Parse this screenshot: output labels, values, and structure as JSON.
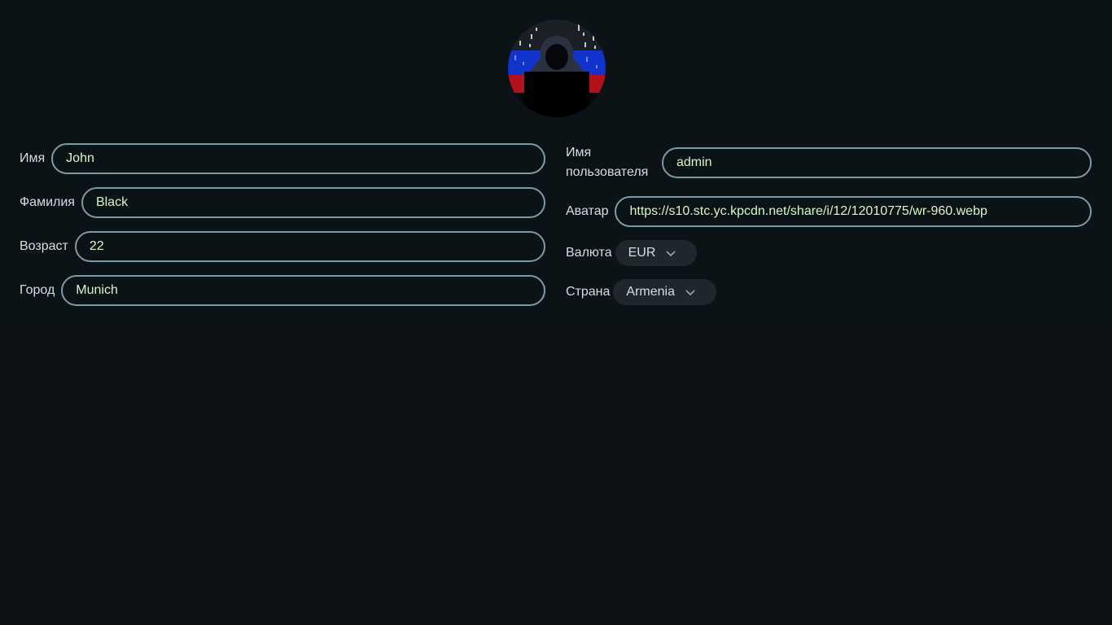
{
  "profile": {
    "avatar_alt": "hooded figure in front of binary code",
    "left_fields": [
      {
        "label": "Имя",
        "value": "John"
      },
      {
        "label": "Фамилия",
        "value": "Black"
      },
      {
        "label": "Возраст",
        "value": "22"
      },
      {
        "label": "Город",
        "value": "Munich"
      }
    ],
    "username": {
      "label": "Имя пользователя",
      "value": "admin"
    },
    "avatar_url": {
      "label": "Аватар",
      "value": "https://s10.stc.yc.kpcdn.net/share/i/12/12010775/wr-960.webp"
    },
    "currency": {
      "label": "Валюта",
      "value": "EUR"
    },
    "country": {
      "label": "Страна",
      "value": "Armenia"
    }
  },
  "colors": {
    "background": "#0b1115",
    "input_border": "#7e9aa8",
    "input_text": "#d7f5c9",
    "select_bg": "#1f272c"
  }
}
